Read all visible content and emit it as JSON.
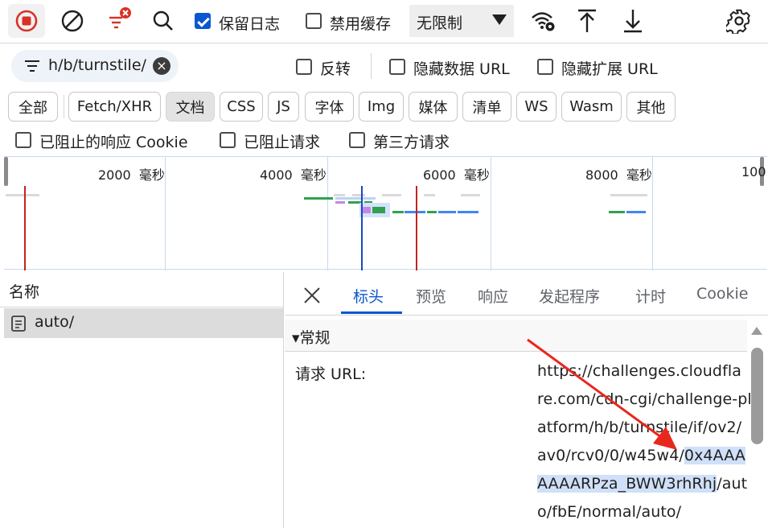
{
  "toolbar": {
    "preserve_log_label": "保留日志",
    "disable_cache_label": "禁用缓存",
    "throttle_value": "无限制",
    "preserve_log_checked": true,
    "disable_cache_checked": false
  },
  "filter": {
    "value": "h/b/turnstile/",
    "invert_label": "反转",
    "hide_data_url_label": "隐藏数据 URL",
    "hide_ext_url_label": "隐藏扩展 URL"
  },
  "type_filters": [
    "全部",
    "Fetch/XHR",
    "文档",
    "CSS",
    "JS",
    "字体",
    "Img",
    "媒体",
    "清单",
    "WS",
    "Wasm",
    "其他"
  ],
  "type_selected": "文档",
  "extra_filters": {
    "blocked_cookies_label": "已阻止的响应 Cookie",
    "blocked_requests_label": "已阻止请求",
    "third_party_label": "第三方请求"
  },
  "overview": {
    "ticks": [
      {
        "value": "2000",
        "unit": "毫秒"
      },
      {
        "value": "4000",
        "unit": "毫秒"
      },
      {
        "value": "6000",
        "unit": "毫秒"
      },
      {
        "value": "8000",
        "unit": "毫秒"
      },
      {
        "value": "100",
        "unit": ""
      }
    ]
  },
  "request_list": {
    "header": "名称",
    "rows": [
      {
        "name": "auto/",
        "selected": true
      }
    ]
  },
  "detail": {
    "tabs": [
      "标头",
      "预览",
      "响应",
      "发起程序",
      "计时",
      "Cookie"
    ],
    "active_tab": "标头",
    "section_title": "▾常规",
    "request_url_label": "请求 URL:",
    "url_lines": [
      "https://challenges.cloudfla",
      "re.com/cdn-cgi/challenge-pl",
      "atform/h/b/turnstile/if/ov2/"
    ],
    "url_line4_plain": "av0/rcv0/0/w45w4/",
    "url_line4_sel": "0x4AAA",
    "url_line5_sel": "AAAARPza_BWW3rhRhj",
    "url_line5_plain": "/aut",
    "url_line6": "o/fbE/normal/auto/"
  },
  "colors": {
    "accent": "#0b57d0",
    "record_red": "#d93025",
    "selection": "#cfe0f8",
    "annotation_arrow": "#e8281e"
  }
}
